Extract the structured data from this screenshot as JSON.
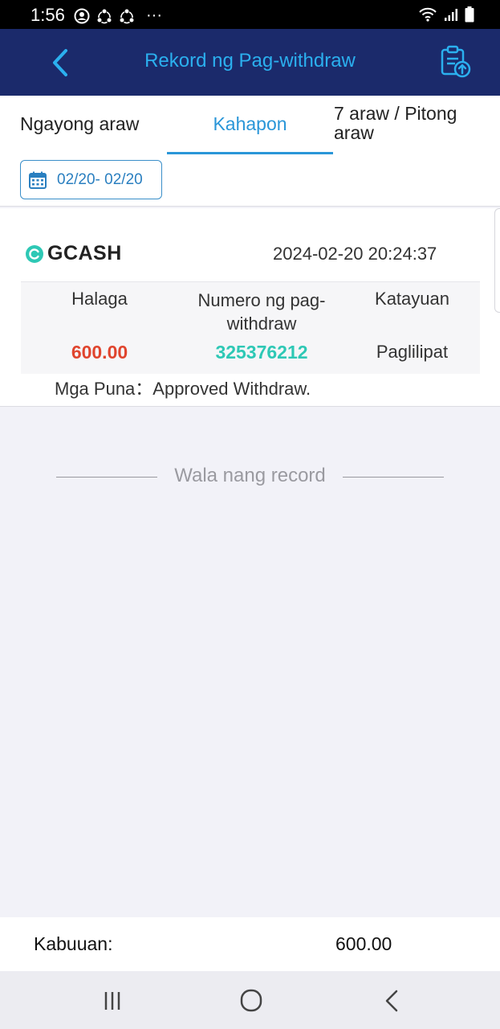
{
  "status_bar": {
    "time": "1:56",
    "dots": "···"
  },
  "header": {
    "title": "Rekord ng Pag-withdraw"
  },
  "tabs": [
    {
      "label": "Ngayong araw"
    },
    {
      "label": "Kahapon",
      "active": true
    },
    {
      "label_line1": "7 araw / Pitong",
      "label_line2": "araw"
    }
  ],
  "date_filter": {
    "range": "02/20- 02/20"
  },
  "record": {
    "provider": "GCASH",
    "datetime": "2024-02-20 20:24:37",
    "columns": {
      "amount_label": "Halaga",
      "number_label_line1": "Numero ng pag-",
      "number_label_line2": "withdraw",
      "status_label": "Katayuan"
    },
    "amount": "600.00",
    "withdraw_number": "325376212",
    "status": "Paglilipat",
    "remarks": "Mga Puna：Approved Withdraw."
  },
  "no_more_text": "Wala nang record",
  "total": {
    "label": "Kabuuan:",
    "value": "600.00"
  },
  "colors": {
    "header_bg": "#1b2a6b",
    "accent": "#2a96d8",
    "amount": "#e0452e",
    "withdraw_number": "#2ec8b5"
  }
}
